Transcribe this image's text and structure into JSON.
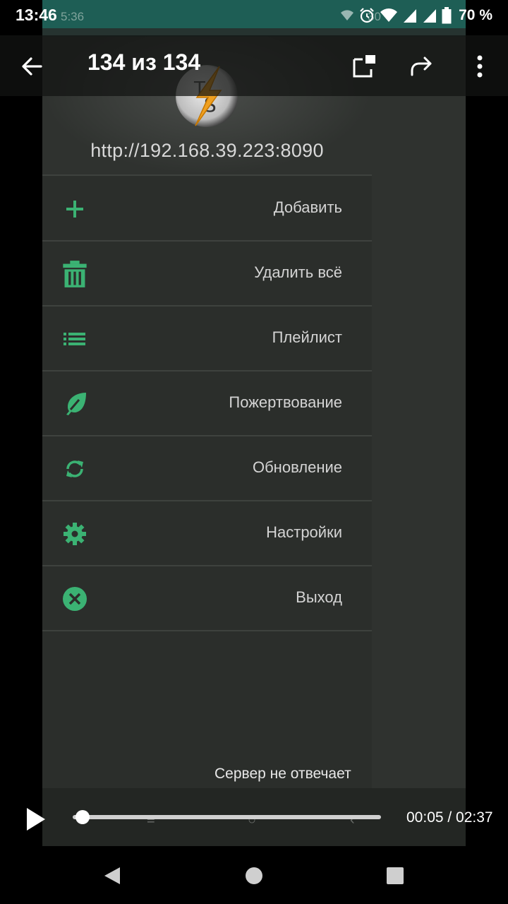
{
  "status_bar": {
    "time": "13:46",
    "battery_percent": "70 %",
    "icons": [
      "wifi-icon",
      "alarm-icon",
      "signal-icon",
      "signal-icon",
      "battery-icon"
    ]
  },
  "viewer": {
    "title": "134 из 134",
    "icons": [
      "back-arrow-icon",
      "open-external-icon",
      "share-icon",
      "more-vert-icon"
    ]
  },
  "embedded": {
    "status_ghost_time": "5:36",
    "status_ghost_right": "30",
    "server_url": "http://192.168.39.223:8090",
    "menu": [
      {
        "label": "Добавить",
        "icon": "plus-icon"
      },
      {
        "label": "Удалить всё",
        "icon": "trash-icon"
      },
      {
        "label": "Плейлист",
        "icon": "list-icon"
      },
      {
        "label": "Пожертвование",
        "icon": "donate-icon"
      },
      {
        "label": "Обновление",
        "icon": "refresh-icon"
      },
      {
        "label": "Настройки",
        "icon": "gear-icon"
      },
      {
        "label": "Выход",
        "icon": "close-circle-icon"
      }
    ],
    "server_status": "Сервер не отвечает",
    "accent_color": "#3bb273"
  },
  "player": {
    "time_current": "00:05",
    "time_total": "02:37",
    "time_display": "00:05 / 02:37",
    "progress_fraction": 0.032
  },
  "colors": {
    "accent_green": "#3bb273",
    "teal_bar": "#1e5e55",
    "drawer_bg": "#2b2e2b"
  }
}
